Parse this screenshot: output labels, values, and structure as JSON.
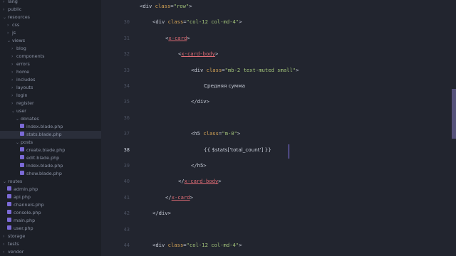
{
  "sidebar": {
    "items": [
      {
        "label": "lang",
        "type": "folder",
        "state": "closed",
        "depth": 0
      },
      {
        "label": "public",
        "type": "folder",
        "state": "closed",
        "depth": 0
      },
      {
        "label": "resources",
        "type": "folder",
        "state": "open",
        "depth": 0
      },
      {
        "label": "css",
        "type": "folder",
        "state": "closed",
        "depth": 1
      },
      {
        "label": "js",
        "type": "folder",
        "state": "closed",
        "depth": 1
      },
      {
        "label": "views",
        "type": "folder",
        "state": "open",
        "depth": 1
      },
      {
        "label": "blog",
        "type": "folder",
        "state": "closed",
        "depth": 2
      },
      {
        "label": "components",
        "type": "folder",
        "state": "closed",
        "depth": 2
      },
      {
        "label": "errors",
        "type": "folder",
        "state": "closed",
        "depth": 2
      },
      {
        "label": "home",
        "type": "folder",
        "state": "closed",
        "depth": 2
      },
      {
        "label": "includes",
        "type": "folder",
        "state": "closed",
        "depth": 2
      },
      {
        "label": "layouts",
        "type": "folder",
        "state": "closed",
        "depth": 2
      },
      {
        "label": "login",
        "type": "folder",
        "state": "closed",
        "depth": 2
      },
      {
        "label": "register",
        "type": "folder",
        "state": "closed",
        "depth": 2
      },
      {
        "label": "user",
        "type": "folder",
        "state": "open",
        "depth": 2
      },
      {
        "label": "donates",
        "type": "folder",
        "state": "open",
        "depth": 3
      },
      {
        "label": "index.blade.php",
        "type": "file",
        "depth": 4
      },
      {
        "label": "stats.blade.php",
        "type": "file",
        "depth": 4,
        "selected": true
      },
      {
        "label": "posts",
        "type": "folder",
        "state": "open",
        "depth": 3
      },
      {
        "label": "create.blade.php",
        "type": "file",
        "depth": 4
      },
      {
        "label": "edit.blade.php",
        "type": "file",
        "depth": 4
      },
      {
        "label": "index.blade.php",
        "type": "file",
        "depth": 4
      },
      {
        "label": "show.blade.php",
        "type": "file",
        "depth": 4
      },
      {
        "label": "routes",
        "type": "folder",
        "state": "open",
        "depth": 0
      },
      {
        "label": "admin.php",
        "type": "file",
        "depth": 1
      },
      {
        "label": "api.php",
        "type": "file",
        "depth": 1
      },
      {
        "label": "channels.php",
        "type": "file",
        "depth": 1
      },
      {
        "label": "console.php",
        "type": "file",
        "depth": 1
      },
      {
        "label": "main.php",
        "type": "file",
        "depth": 1
      },
      {
        "label": "user.php",
        "type": "file",
        "depth": 1
      },
      {
        "label": "storage",
        "type": "folder",
        "state": "closed",
        "depth": 0
      },
      {
        "label": "tests",
        "type": "folder",
        "state": "closed",
        "depth": 0
      },
      {
        "label": "vendor",
        "type": "folder",
        "state": "closed",
        "depth": 0
      }
    ]
  },
  "editor": {
    "active_line": "38",
    "lines": [
      {
        "num": "",
        "indent": 0,
        "parts": [
          [
            "tag",
            "<div "
          ],
          [
            "attr",
            "class"
          ],
          [
            "tag",
            "="
          ],
          [
            "str",
            "\"row\""
          ],
          [
            "tag",
            ">"
          ]
        ]
      },
      {
        "num": "30",
        "indent": 1,
        "parts": [
          [
            "tag",
            "<div "
          ],
          [
            "attr",
            "class"
          ],
          [
            "tag",
            "="
          ],
          [
            "str",
            "\"col-12 col-md-4\""
          ],
          [
            "tag",
            ">"
          ]
        ]
      },
      {
        "num": "31",
        "indent": 2,
        "parts": [
          [
            "tag",
            "<"
          ],
          [
            "ctag",
            "x-card"
          ],
          [
            "tag",
            ">"
          ]
        ]
      },
      {
        "num": "32",
        "indent": 3,
        "parts": [
          [
            "tag",
            "<"
          ],
          [
            "ctag",
            "x-card-body"
          ],
          [
            "tag",
            ">"
          ]
        ]
      },
      {
        "num": "33",
        "indent": 4,
        "parts": [
          [
            "tag",
            "<div "
          ],
          [
            "attr",
            "class"
          ],
          [
            "tag",
            "="
          ],
          [
            "str",
            "\"mb-2 text-muted small\""
          ],
          [
            "tag",
            ">"
          ]
        ]
      },
      {
        "num": "34",
        "indent": 5,
        "parts": [
          [
            "text",
            "Средняя сумма"
          ]
        ]
      },
      {
        "num": "35",
        "indent": 4,
        "parts": [
          [
            "tag",
            "</div>"
          ]
        ]
      },
      {
        "num": "36",
        "indent": 0,
        "parts": []
      },
      {
        "num": "37",
        "indent": 4,
        "parts": [
          [
            "tag",
            "<h5 "
          ],
          [
            "attr",
            "class"
          ],
          [
            "tag",
            "="
          ],
          [
            "str",
            "\"m-0\""
          ],
          [
            "tag",
            ">"
          ]
        ]
      },
      {
        "num": "38",
        "indent": 5,
        "parts": [
          [
            "text",
            "{{ $stats['total_count'] }}"
          ]
        ]
      },
      {
        "num": "39",
        "indent": 4,
        "parts": [
          [
            "tag",
            "</h5>"
          ]
        ]
      },
      {
        "num": "40",
        "indent": 3,
        "parts": [
          [
            "tag",
            "</"
          ],
          [
            "ctag",
            "x-card-body"
          ],
          [
            "tag",
            ">"
          ]
        ]
      },
      {
        "num": "41",
        "indent": 2,
        "parts": [
          [
            "tag",
            "</"
          ],
          [
            "ctag",
            "x-card"
          ],
          [
            "tag",
            ">"
          ]
        ]
      },
      {
        "num": "42",
        "indent": 1,
        "parts": [
          [
            "tag",
            "</div>"
          ]
        ]
      },
      {
        "num": "43",
        "indent": 0,
        "parts": []
      },
      {
        "num": "44",
        "indent": 1,
        "parts": [
          [
            "tag",
            "<div "
          ],
          [
            "attr",
            "class"
          ],
          [
            "tag",
            "="
          ],
          [
            "str",
            "\"col-12 col-md-4\""
          ],
          [
            "tag",
            ">"
          ]
        ]
      }
    ]
  }
}
